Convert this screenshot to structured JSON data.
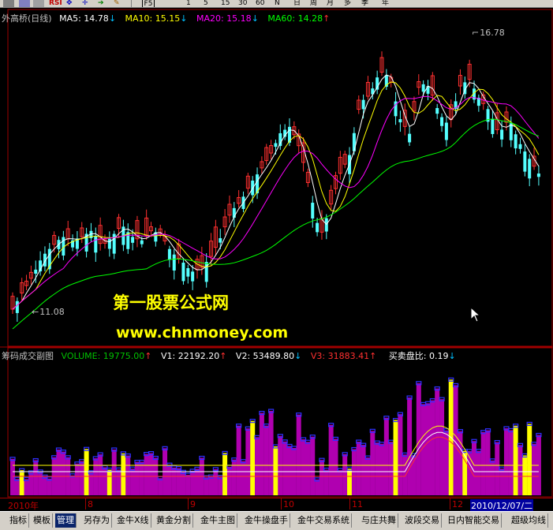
{
  "toolbar": {
    "period_buttons": [
      "1",
      "5",
      "15",
      "30",
      "60",
      "N",
      "日",
      "周",
      "月",
      "多",
      "季",
      "年"
    ],
    "icon_label_rsi": "RSI",
    "icon_label_f5": "F5"
  },
  "price_panel": {
    "stock_name": "外高桥(日线)",
    "ma5": "MA5: 14.78",
    "ma10": "MA10: 15.15",
    "ma20": "MA20: 15.18",
    "ma60": "MA60: 14.28",
    "high_label": "16.78",
    "low_label": "11.08",
    "colors": {
      "ma5": "#ffffff",
      "ma10": "#ffff00",
      "ma20": "#ff00ff",
      "ma60": "#00ff00",
      "up": "#ff3030",
      "down": "#54ffff"
    }
  },
  "watermark": {
    "title": "第一股票公式网",
    "url": "www.chnmoney.com"
  },
  "volume_panel": {
    "indicator_name": "筹码成交副图",
    "volume": "VOLUME: 19775.00",
    "v1": "V1: 22192.20",
    "v2": "V2: 53489.80",
    "v3": "V3: 31883.41",
    "ratio": "买卖盘比: 0.19"
  },
  "date_axis": {
    "year_label": "2010年",
    "month_labels": [
      "8",
      "9",
      "10",
      "11",
      "12"
    ],
    "current_date": "2010/12/07/二"
  },
  "tabs": [
    "指标",
    "模板",
    "管理",
    "另存为",
    "金牛X线",
    "黄金分割",
    "金牛主图",
    "金牛操盘手",
    "金牛交易系统",
    "与庄共舞",
    "波段交易",
    "日内智能交易",
    "超级均线"
  ],
  "active_tab": "管理"
}
